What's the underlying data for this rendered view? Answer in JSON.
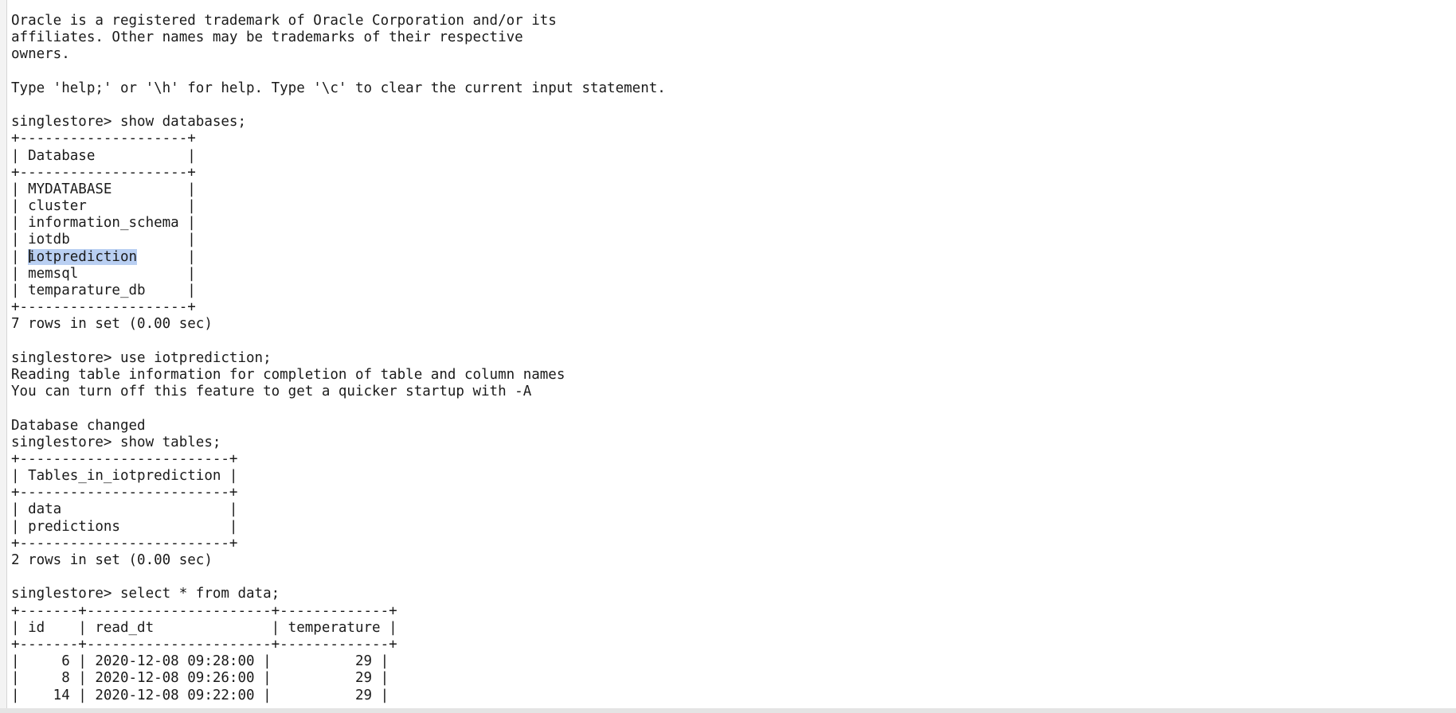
{
  "terminal": {
    "lines": [
      {
        "pre": "Oracle is a registered trademark of Oracle Corporation and/or its"
      },
      {
        "pre": "affiliates. Other names may be trademarks of their respective"
      },
      {
        "pre": "owners."
      },
      {
        "pre": ""
      },
      {
        "pre": "Type 'help;' or '\\h' for help. Type '\\c' to clear the current input statement."
      },
      {
        "pre": ""
      },
      {
        "pre": "singlestore> show databases;"
      },
      {
        "pre": "+--------------------+"
      },
      {
        "pre": "| Database           |"
      },
      {
        "pre": "+--------------------+"
      },
      {
        "pre": "| MYDATABASE         |"
      },
      {
        "pre": "| cluster            |"
      },
      {
        "pre": "| information_schema |"
      },
      {
        "pre": "| iotdb              |"
      },
      {
        "pre": "| ",
        "hl": "iotprediction",
        "post": "      |"
      },
      {
        "pre": "| memsql             |"
      },
      {
        "pre": "| temparature_db     |"
      },
      {
        "pre": "+--------------------+"
      },
      {
        "pre": "7 rows in set (0.00 sec)"
      },
      {
        "pre": ""
      },
      {
        "pre": "singlestore> use iotprediction;"
      },
      {
        "pre": "Reading table information for completion of table and column names"
      },
      {
        "pre": "You can turn off this feature to get a quicker startup with -A"
      },
      {
        "pre": ""
      },
      {
        "pre": "Database changed"
      },
      {
        "pre": "singlestore> show tables;"
      },
      {
        "pre": "+-------------------------+"
      },
      {
        "pre": "| Tables_in_iotprediction |"
      },
      {
        "pre": "+-------------------------+"
      },
      {
        "pre": "| data                    |"
      },
      {
        "pre": "| predictions             |"
      },
      {
        "pre": "+-------------------------+"
      },
      {
        "pre": "2 rows in set (0.00 sec)"
      },
      {
        "pre": ""
      },
      {
        "pre": "singlestore> select * from data;"
      },
      {
        "pre": "+-------+----------------------+-------------+"
      },
      {
        "pre": "| id    | read_dt              | temperature |"
      },
      {
        "pre": "+-------+----------------------+-------------+"
      },
      {
        "pre": "|     6 | 2020-12-08 09:28:00 |          29 |"
      },
      {
        "pre": "|     8 | 2020-12-08 09:26:00 |          29 |"
      },
      {
        "pre": "|    14 | 2020-12-08 09:22:00 |          29 |"
      }
    ],
    "cursor_icon": "text-cursor-icon",
    "highlight_color": "#b9cff2"
  }
}
